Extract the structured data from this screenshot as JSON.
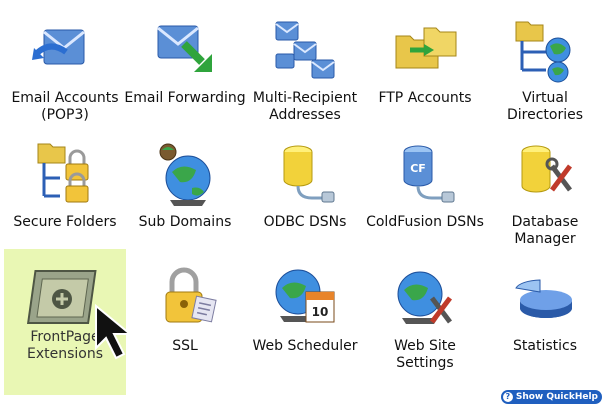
{
  "tiles": [
    {
      "label": "Email Accounts\n(POP3)",
      "icon": "email-accounts-icon"
    },
    {
      "label": "Email Forwarding",
      "icon": "email-forwarding-icon"
    },
    {
      "label": "Multi-Recipient\nAddresses",
      "icon": "multi-recipient-icon"
    },
    {
      "label": "FTP Accounts",
      "icon": "ftp-accounts-icon"
    },
    {
      "label": "Virtual\nDirectories",
      "icon": "virtual-directories-icon"
    },
    {
      "label": "Secure Folders",
      "icon": "secure-folders-icon"
    },
    {
      "label": "Sub Domains",
      "icon": "sub-domains-icon"
    },
    {
      "label": "ODBC DSNs",
      "icon": "odbc-dsn-icon"
    },
    {
      "label": "ColdFusion DSNs",
      "icon": "coldfusion-dsn-icon"
    },
    {
      "label": "Database\nManager",
      "icon": "database-manager-icon"
    },
    {
      "label": "FrontPage\nExtensions",
      "icon": "frontpage-extensions-icon",
      "highlighted": true
    },
    {
      "label": "SSL",
      "icon": "ssl-lock-icon"
    },
    {
      "label": "Web Scheduler",
      "icon": "web-scheduler-icon"
    },
    {
      "label": "Web Site\nSettings",
      "icon": "web-site-settings-icon"
    },
    {
      "label": "Statistics",
      "icon": "statistics-pie-icon"
    }
  ],
  "icon_badges": {
    "coldfusion": "CF",
    "calendar_day": "10"
  },
  "quickhelp": {
    "label": "Show QuickHelp",
    "symbol": "?"
  },
  "colors": {
    "highlight": "#e9f7b4",
    "quickhelp": "#1f5fbf"
  }
}
